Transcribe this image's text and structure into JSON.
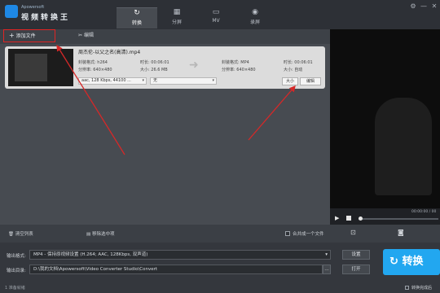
{
  "app": {
    "brand_small": "Apowersoft",
    "brand_name": "视频转换王"
  },
  "window_controls": {
    "settings": "⚙",
    "minimize": "—",
    "close": "✕"
  },
  "tabs": [
    {
      "label": "转换",
      "icon": "convert-icon",
      "glyph": "↻",
      "active": true
    },
    {
      "label": "分屏",
      "icon": "split-screen-icon",
      "glyph": "▦",
      "active": false
    },
    {
      "label": "MV",
      "icon": "tv-icon",
      "glyph": "▭",
      "active": false
    },
    {
      "label": "录屏",
      "icon": "record-icon",
      "glyph": "◉",
      "active": false
    }
  ],
  "toolbar": {
    "add_file": "添加文件",
    "edit": "编辑",
    "add_glyph": "+",
    "edit_glyph": "✂"
  },
  "file": {
    "name": "周杰伦-以父之名(高清).mp4",
    "source": {
      "format_label": "封装格式: h264",
      "resolution_label": "分辨率: 640×480",
      "duration_label": "时长: 00:06:01",
      "size_label": "大小: 26.6 MB"
    },
    "target": {
      "format_label": "封装格式: MP4",
      "resolution_label": "分辨率: 640×480",
      "duration_label": "时长: 00:06:01",
      "size_label": "大小: 自动"
    },
    "audio_select": "aac, 128 Kbps, 44100 ...",
    "subtitle_select": "无",
    "size_button": "大小",
    "edit_button": "编辑"
  },
  "player": {
    "time": "00:00:00 / 00"
  },
  "actions": {
    "clear_list": "清空列表",
    "remove_selected": "移除选中项",
    "merge_label": "合并成一个文件"
  },
  "output": {
    "format_label": "输出格式:",
    "format_value": "MP4 - 保持原视频设置 (H.264; AAC, 128Kbps, 双声道)",
    "settings_button": "设置",
    "dir_label": "输出目录:",
    "dir_value": "D:\\我的文档\\Apowersoft\\Video Converter Studio\\Convert",
    "open_button": "打开",
    "dir_browse": "…"
  },
  "convert_button": "转换",
  "status": {
    "left": "1 准备就绪",
    "after_convert": "转换完成后"
  },
  "colors": {
    "accent": "#22a7f0",
    "highlight": "#e02424"
  }
}
